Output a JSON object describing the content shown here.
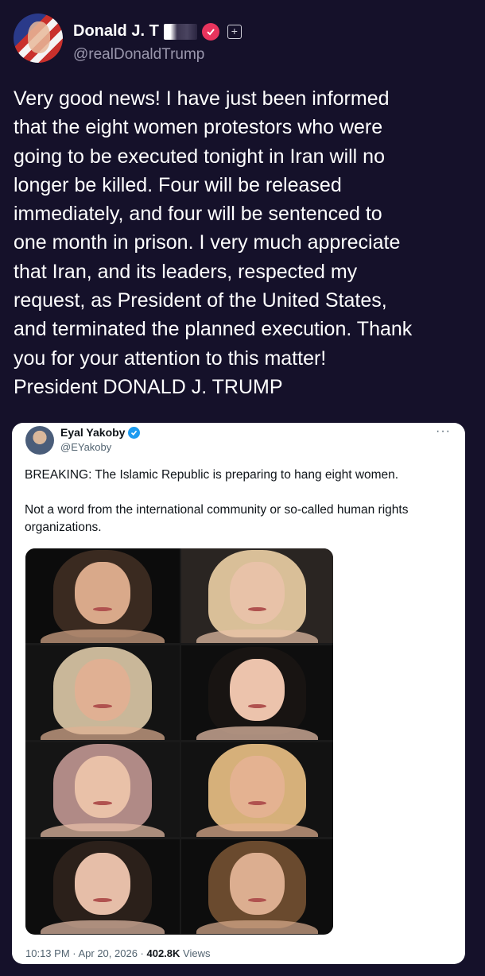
{
  "author": {
    "name": "Donald J. T",
    "handle": "@realDonaldTrump"
  },
  "post": {
    "text": "Very good news! I have just been informed\nthat the eight women protestors who were\ngoing to be executed tonight in Iran will no\nlonger be killed. Four will be released\nimmediately, and four will be sentenced to\none month in prison. I very much appreciate\nthat Iran, and its leaders, respected my\nrequest, as President of the United States,\nand terminated the planned execution. Thank\nyou for your attention to this matter!\nPresident DONALD J. TRUMP"
  },
  "quoted": {
    "name": "Eyal Yakoby",
    "handle": "@EYakoby",
    "more": "···",
    "paragraph1": "BREAKING: The Islamic Republic is preparing to hang eight women.",
    "paragraph2": "Not a word from the international community or so-called human rights organizations.",
    "time": "10:13 PM · Apr 20, 2026 · ",
    "views_count": "402.8K",
    "views_label": " Views",
    "photos": [
      {
        "hair": "#3a2a20",
        "skin": "#d9a98a",
        "bg": "#0c0c0c"
      },
      {
        "hair": "#d9bf98",
        "skin": "#e8c2a8",
        "bg": "#2a2522"
      },
      {
        "hair": "#c9b799",
        "skin": "#e0b093",
        "bg": "#131313"
      },
      {
        "hair": "#181412",
        "skin": "#ecc3ac",
        "bg": "#0e0e0e"
      },
      {
        "hair": "#b08a86",
        "skin": "#e9c1a8",
        "bg": "#151515"
      },
      {
        "hair": "#d6b07a",
        "skin": "#e4b291",
        "bg": "#121212"
      },
      {
        "hair": "#2b201a",
        "skin": "#e6bea8",
        "bg": "#0d0d0d"
      },
      {
        "hair": "#6a4a2e",
        "skin": "#dcae90",
        "bg": "#0d0d0d"
      }
    ]
  },
  "colors": {
    "background": "#15112a",
    "verified_badge": "#e8345d",
    "quote_verified": "#1d9bf0"
  }
}
